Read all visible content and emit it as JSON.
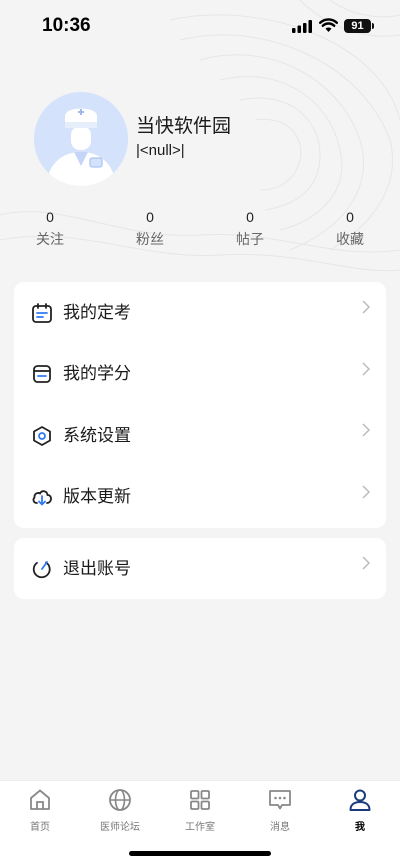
{
  "status_bar": {
    "time": "10:36",
    "battery": "91"
  },
  "profile": {
    "name": "当快软件园",
    "subtitle": "|<null>|"
  },
  "stats": [
    {
      "value": "0",
      "label": "关注"
    },
    {
      "value": "0",
      "label": "粉丝"
    },
    {
      "value": "0",
      "label": "帖子"
    },
    {
      "value": "0",
      "label": "收藏"
    }
  ],
  "menu": [
    {
      "label": "我的定考",
      "icon": "calendar-icon"
    },
    {
      "label": "我的学分",
      "icon": "wallet-icon"
    },
    {
      "label": "系统设置",
      "icon": "settings-hexagon-icon"
    },
    {
      "label": "版本更新",
      "icon": "cloud-download-icon"
    }
  ],
  "logout": {
    "label": "退出账号",
    "icon": "logout-icon"
  },
  "tabbar": {
    "items": [
      {
        "label": "首页",
        "icon": "home-icon"
      },
      {
        "label": "医师论坛",
        "icon": "globe-icon"
      },
      {
        "label": "工作室",
        "icon": "grid-icon"
      },
      {
        "label": "消息",
        "icon": "message-icon"
      },
      {
        "label": "我",
        "icon": "user-icon"
      }
    ],
    "active": "我"
  },
  "colors": {
    "accent": "#1a1a1a",
    "avatar_bg": "#d4e3fb",
    "page_bg": "#f4f4f4"
  }
}
